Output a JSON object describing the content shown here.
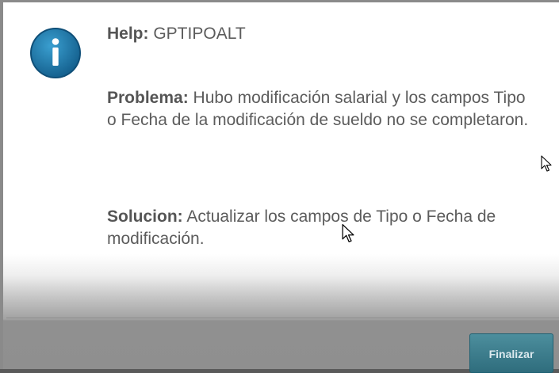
{
  "dialog": {
    "help_label": "Help:",
    "help_value": "GPTIPOALT",
    "problema_label": "Problema:",
    "problema_text": "Hubo modificación salarial y los campos Tipo o Fecha de la modificación de sueldo no se completaron.",
    "solucion_label": "Solucion:",
    "solucion_text": "Actualizar los campos de Tipo o Fecha de modificación."
  },
  "footer": {
    "finalizar_label": "Finalizar"
  },
  "icons": {
    "info": "info-icon",
    "cursor": "mouse-pointer-icon"
  },
  "colors": {
    "icon_blue": "#1f7fb0",
    "button_teal": "#3f7f8f",
    "text": "#5c5c5c"
  }
}
